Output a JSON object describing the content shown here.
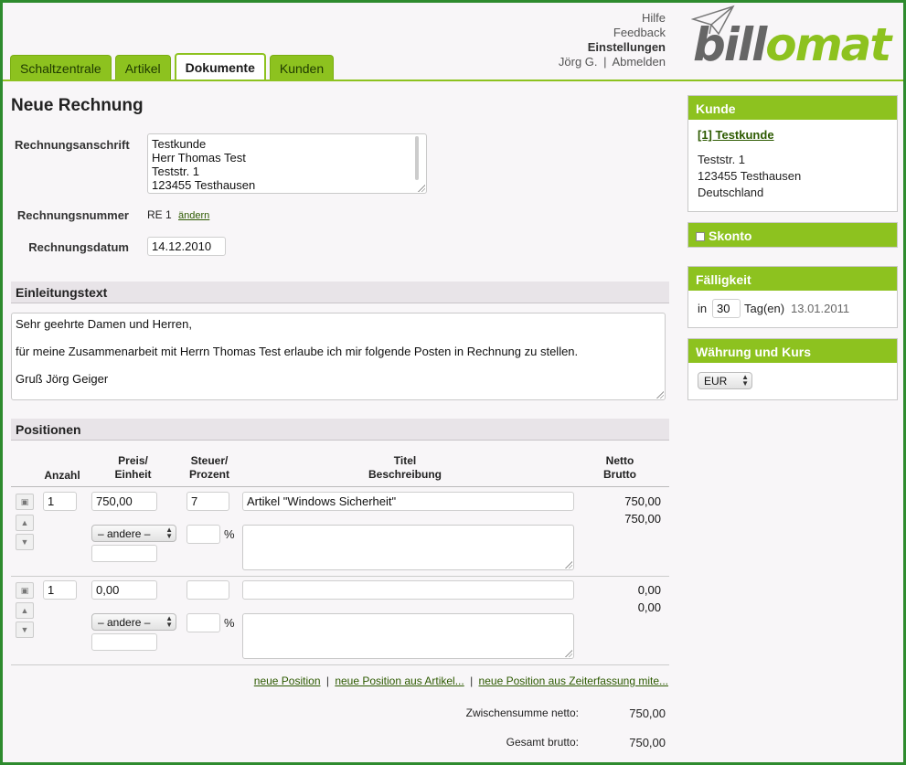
{
  "nav": {
    "tabs": [
      "Schaltzentrale",
      "Artikel",
      "Dokumente",
      "Kunden"
    ],
    "active_tab": "Dokumente",
    "links": {
      "help": "Hilfe",
      "feedback": "Feedback",
      "settings": "Einstellungen",
      "user": "Jörg G.",
      "separator": "|",
      "logout": "Abmelden"
    },
    "logo": {
      "part1": "bill",
      "part2": "omat"
    }
  },
  "invoice": {
    "title": "Neue Rechnung",
    "address_label": "Rechnungsanschrift",
    "address_lines": [
      "Testkunde",
      "Herr Thomas Test",
      "Teststr. 1",
      "123455 Testhausen"
    ],
    "number_label": "Rechnungsnummer",
    "number_value": "RE 1",
    "number_change": "ändern",
    "date_label": "Rechnungsdatum",
    "date_value": "14.12.2010"
  },
  "intro": {
    "heading": "Einleitungstext",
    "lines": [
      "Sehr geehrte Damen und Herren,",
      "für meine Zusammenarbeit mit Herrn Thomas Test erlaube ich mir folgende Posten in Rechnung zu stellen.",
      "Gruß Jörg Geiger"
    ]
  },
  "positions": {
    "heading": "Positionen",
    "columns": {
      "qty": "Anzahl",
      "price_1": "Preis/",
      "price_2": "Einheit",
      "tax_1": "Steuer/",
      "tax_2": "Prozent",
      "title_1": "Titel",
      "title_2": "Beschreibung",
      "net_1": "Netto",
      "net_2": "Brutto"
    },
    "rows": [
      {
        "qty": "1",
        "price": "750,00",
        "tax": "7",
        "title": "Artikel \"Windows Sicherheit\"",
        "unit_select": "– andere –",
        "pct": "%",
        "net": "750,00",
        "gross": "750,00"
      },
      {
        "qty": "1",
        "price": "0,00",
        "tax": "",
        "title": "",
        "unit_select": "– andere –",
        "pct": "%",
        "net": "0,00",
        "gross": "0,00"
      }
    ],
    "add_links": [
      "neue Position",
      "neue Position aus Artikel...",
      "neue Position aus Zeiterfassung mite..."
    ],
    "link_sep": "|",
    "subtotal_label": "Zwischensumme netto:",
    "subtotal_value": "750,00",
    "total_label": "Gesamt brutto:",
    "total_value": "750,00"
  },
  "sidebar": {
    "customer": {
      "heading": "Kunde",
      "link": "[1] Testkunde",
      "lines": [
        "Teststr. 1",
        "123455 Testhausen",
        "Deutschland"
      ]
    },
    "discount": {
      "heading": "Skonto"
    },
    "due": {
      "heading": "Fälligkeit",
      "prefix": "in",
      "days": "30",
      "unit": "Tag(en)",
      "date": "13.01.2011"
    },
    "currency": {
      "heading": "Währung und Kurs",
      "value": "EUR"
    }
  },
  "colors": {
    "accent": "#8dc21f",
    "frame": "#2e8b2e",
    "link": "#2d5a00"
  }
}
